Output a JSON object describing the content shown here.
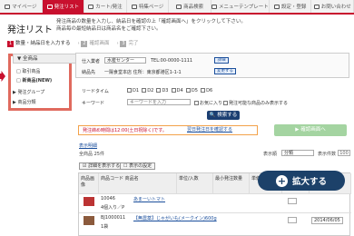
{
  "navbar": {
    "items": [
      {
        "label": "マイページ",
        "icon": "home-icon"
      },
      {
        "label": "発注リスト",
        "icon": "list-icon",
        "active": true
      },
      {
        "label": "カート/発注",
        "icon": "cart-icon"
      },
      {
        "label": "特集ページ",
        "icon": "star-icon"
      },
      {
        "label": "商品検索",
        "icon": "search-icon"
      },
      {
        "label": "メニューテンプレート",
        "icon": "template-icon"
      },
      {
        "label": "設定・登録",
        "icon": "gear-icon"
      },
      {
        "label": "お問い合わせ",
        "icon": "mail-icon"
      }
    ]
  },
  "page": {
    "title": "発注リスト",
    "notice_line1": "発注商品の数量を入力し、納品日を確認の上「確認画面へ」をクリックして下さい。",
    "notice_line2": "商品毎の最短納品日は商品名をご確認下さい。"
  },
  "steps": [
    {
      "no": "1",
      "label": "数量・納品日を入力する"
    },
    {
      "no": "2",
      "label": "確認画面"
    },
    {
      "no": "3",
      "label": "完了"
    }
  ],
  "sidebar": {
    "title": "全商品",
    "items": [
      "取引商品",
      "新商品(NEW)"
    ],
    "groups": [
      "発注グループ",
      "商品分類"
    ]
  },
  "form": {
    "supplier_label": "仕入業者",
    "supplier_value": "水産センター",
    "tel": "TEL:00-0000-1111",
    "search_btn": "詳細",
    "delivery_label": "納品先",
    "delivery_value": "一陽食堂本店 住所：東京都港区1-1-1",
    "change_btn": "変更する",
    "leadtime_label": "リードタイム",
    "days": [
      "D1",
      "D2",
      "D3",
      "D4",
      "D5",
      "D6"
    ],
    "keyword_label": "キーワード",
    "keyword_placeholder": "キーワードを入力",
    "fav_label": "お気に入り",
    "orderable_label": "発注可能な商品のみ表示する",
    "search_submit": "検索する"
  },
  "alert": {
    "text": "発注締め時間は12:00(土日祝除く)です。",
    "link": "翌日発注日を確認する"
  },
  "confirm_btn": "確認画面へ",
  "table_info": {
    "count": "全商品 25件",
    "display_label": "表示順",
    "per_page": "表示件数",
    "per_page_value": "100",
    "sort_value": "分類",
    "select_link": "表示明細",
    "detail_btn": "詳細を表示する",
    "order_btn": "表示の設定"
  },
  "table": {
    "headers": [
      "商品画像",
      "商品コード\n商品名",
      "単位/入数",
      "最小発注数量",
      "単価",
      "数量",
      "納品日"
    ],
    "rows": [
      {
        "code": "10046",
        "name": "あまーいトマト",
        "tag": "NEW",
        "unit": "4個入り／P",
        "price": "",
        "qty": "",
        "date": ""
      },
      {
        "code": "BJ1000011",
        "name": "【無農薬】じゃがいも(メークイン)600g",
        "tag": "NEW",
        "unit": "1袋",
        "price": "",
        "qty": "",
        "date": "2014/06/05"
      }
    ],
    "row_check": "選択中"
  },
  "zoom": {
    "label": "拡大する",
    "icon": "plus-icon"
  },
  "colors": {
    "accent": "#c8102e",
    "nav_active": "#c8102e",
    "zoom_bg": "#1c4169"
  }
}
